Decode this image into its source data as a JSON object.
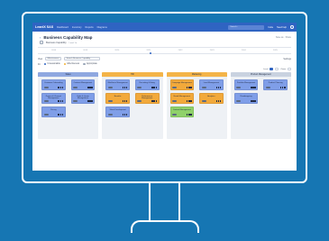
{
  "app": {
    "logo": "LeanIX SAS",
    "nav": [
      "Dashboard",
      "Inventory",
      "Reports",
      "Diagrams"
    ],
    "search_placeholder": "Search...",
    "actions": [
      "Invite",
      "Need help"
    ]
  },
  "header": {
    "title": "Business Capability Map",
    "actions_text": "Save as · Share",
    "subtitle": "Business Capability",
    "subtitle_level": "Level 1 ▾",
    "timeline_labels": [
      "2018",
      "2019",
      "2020",
      "2021",
      "2022",
      "2023",
      "2024",
      "2025"
    ]
  },
  "filters": {
    "view_label": "View",
    "view_value": "Effectiveness",
    "search_placeholder": "Search Business Capability",
    "right_label": "Settings"
  },
  "legend": {
    "label": "Fit",
    "items": [
      {
        "label": "Unreasonable",
        "color": "#2f64c2"
      },
      {
        "label": "Effectiveness",
        "color": "#f2b233"
      },
      {
        "label": "Appropriate",
        "color": "#ffffff"
      }
    ]
  },
  "zoom": {
    "label": "Zoom",
    "level_label": "Level"
  },
  "colors": {
    "blue": "#7f9ee8",
    "orange": "#f2a93b",
    "green": "#8fd16a",
    "head_blue": "#8fa8e0",
    "head_orange": "#f4b448",
    "head_gray": "#c9d2e0"
  },
  "columns": [
    {
      "title": "Sales",
      "head_color": "#8fa8e0",
      "cards": [
        {
          "label": "Customer Onboarding",
          "color": "#7f9ee8"
        },
        {
          "label": "Contract Management",
          "color": "#7f9ee8"
        },
        {
          "label": "Partner & Channel Management",
          "color": "#7f9ee8"
        },
        {
          "label": "Order & Quote Management",
          "color": "#7f9ee8"
        },
        {
          "label": "Pricing",
          "color": "#7f9ee8"
        }
      ]
    },
    {
      "title": "HR",
      "head_color": "#f4b448",
      "cards": [
        {
          "label": "Workforce Management",
          "color": "#7f9ee8"
        },
        {
          "label": "Recruiting & Hiring",
          "color": "#7f9ee8"
        },
        {
          "label": "Benefits",
          "color": "#f2a93b"
        },
        {
          "label": "Performance Management",
          "color": "#f2a93b"
        },
        {
          "label": "Talent Development",
          "color": "#7f9ee8"
        }
      ]
    },
    {
      "title": "Marketing",
      "head_color": "#f4b448",
      "cards": [
        {
          "label": "Campaign Management",
          "color": "#f2a93b"
        },
        {
          "label": "Lead Management",
          "color": "#7f9ee8"
        },
        {
          "label": "Brand Management",
          "color": "#f2a93b"
        },
        {
          "label": "Analytics",
          "color": "#f2a93b"
        },
        {
          "label": "Content Management",
          "color": "#8fd16a"
        }
      ]
    },
    {
      "title": "Product Management",
      "head_color": "#c9d2e0",
      "cards": [
        {
          "label": "Portfolio Management",
          "color": "#7f9ee8"
        },
        {
          "label": "Product Planning",
          "color": "#7f9ee8"
        },
        {
          "label": "Roadmapping",
          "color": "#7f9ee8"
        }
      ]
    }
  ]
}
